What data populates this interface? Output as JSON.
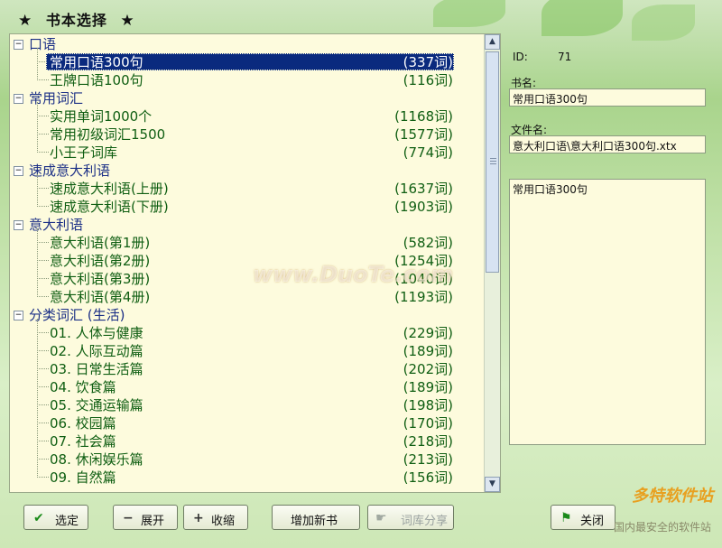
{
  "window": {
    "title": "书本选择"
  },
  "tree": {
    "groups": [
      {
        "label": "口语",
        "items": [
          {
            "name": "常用口语300句",
            "count": "(337词)",
            "selected": true
          },
          {
            "name": "王牌口语100句",
            "count": "(116词)"
          }
        ]
      },
      {
        "label": "常用词汇",
        "items": [
          {
            "name": "实用单词1000个",
            "count": "(1168词)"
          },
          {
            "name": "常用初级词汇1500",
            "count": "(1577词)"
          },
          {
            "name": "小王子词库",
            "count": "(774词)"
          }
        ]
      },
      {
        "label": "速成意大利语",
        "items": [
          {
            "name": "速成意大利语(上册)",
            "count": "(1637词)"
          },
          {
            "name": "速成意大利语(下册)",
            "count": "(1903词)"
          }
        ]
      },
      {
        "label": "意大利语",
        "items": [
          {
            "name": "意大利语(第1册)",
            "count": "(582词)"
          },
          {
            "name": "意大利语(第2册)",
            "count": "(1254词)"
          },
          {
            "name": "意大利语(第3册)",
            "count": "(1040词)"
          },
          {
            "name": "意大利语(第4册)",
            "count": "(1193词)"
          }
        ]
      },
      {
        "label": "分类词汇 (生活)",
        "items": [
          {
            "name": "01. 人体与健康",
            "count": "(229词)"
          },
          {
            "name": "02. 人际互动篇",
            "count": "(189词)"
          },
          {
            "name": "03. 日常生活篇",
            "count": "(202词)"
          },
          {
            "name": "04. 饮食篇",
            "count": "(189词)"
          },
          {
            "name": "05. 交通运输篇",
            "count": "(198词)"
          },
          {
            "name": "06. 校园篇",
            "count": "(170词)"
          },
          {
            "name": "07. 社会篇",
            "count": "(218词)"
          },
          {
            "name": "08. 休闲娱乐篇",
            "count": "(213词)"
          },
          {
            "name": "09. 自然篇",
            "count": "(156词)"
          }
        ]
      }
    ]
  },
  "details": {
    "id_label": "ID:",
    "id_value": "71",
    "book_label": "书名:",
    "book_value": "常用口语300句",
    "file_label": "文件名:",
    "file_value": "意大利口语\\意大利口语300句.xtx",
    "memo": "常用口语300句"
  },
  "buttons": {
    "select": "选定",
    "expand": "展开",
    "collapse": "收缩",
    "add_book": "增加新书",
    "share": "词库分享",
    "close": "关闭"
  },
  "watermark": {
    "main": "www.DuoTe.com",
    "brand": "多特软件站",
    "slogan": "国内最安全的软件站"
  }
}
